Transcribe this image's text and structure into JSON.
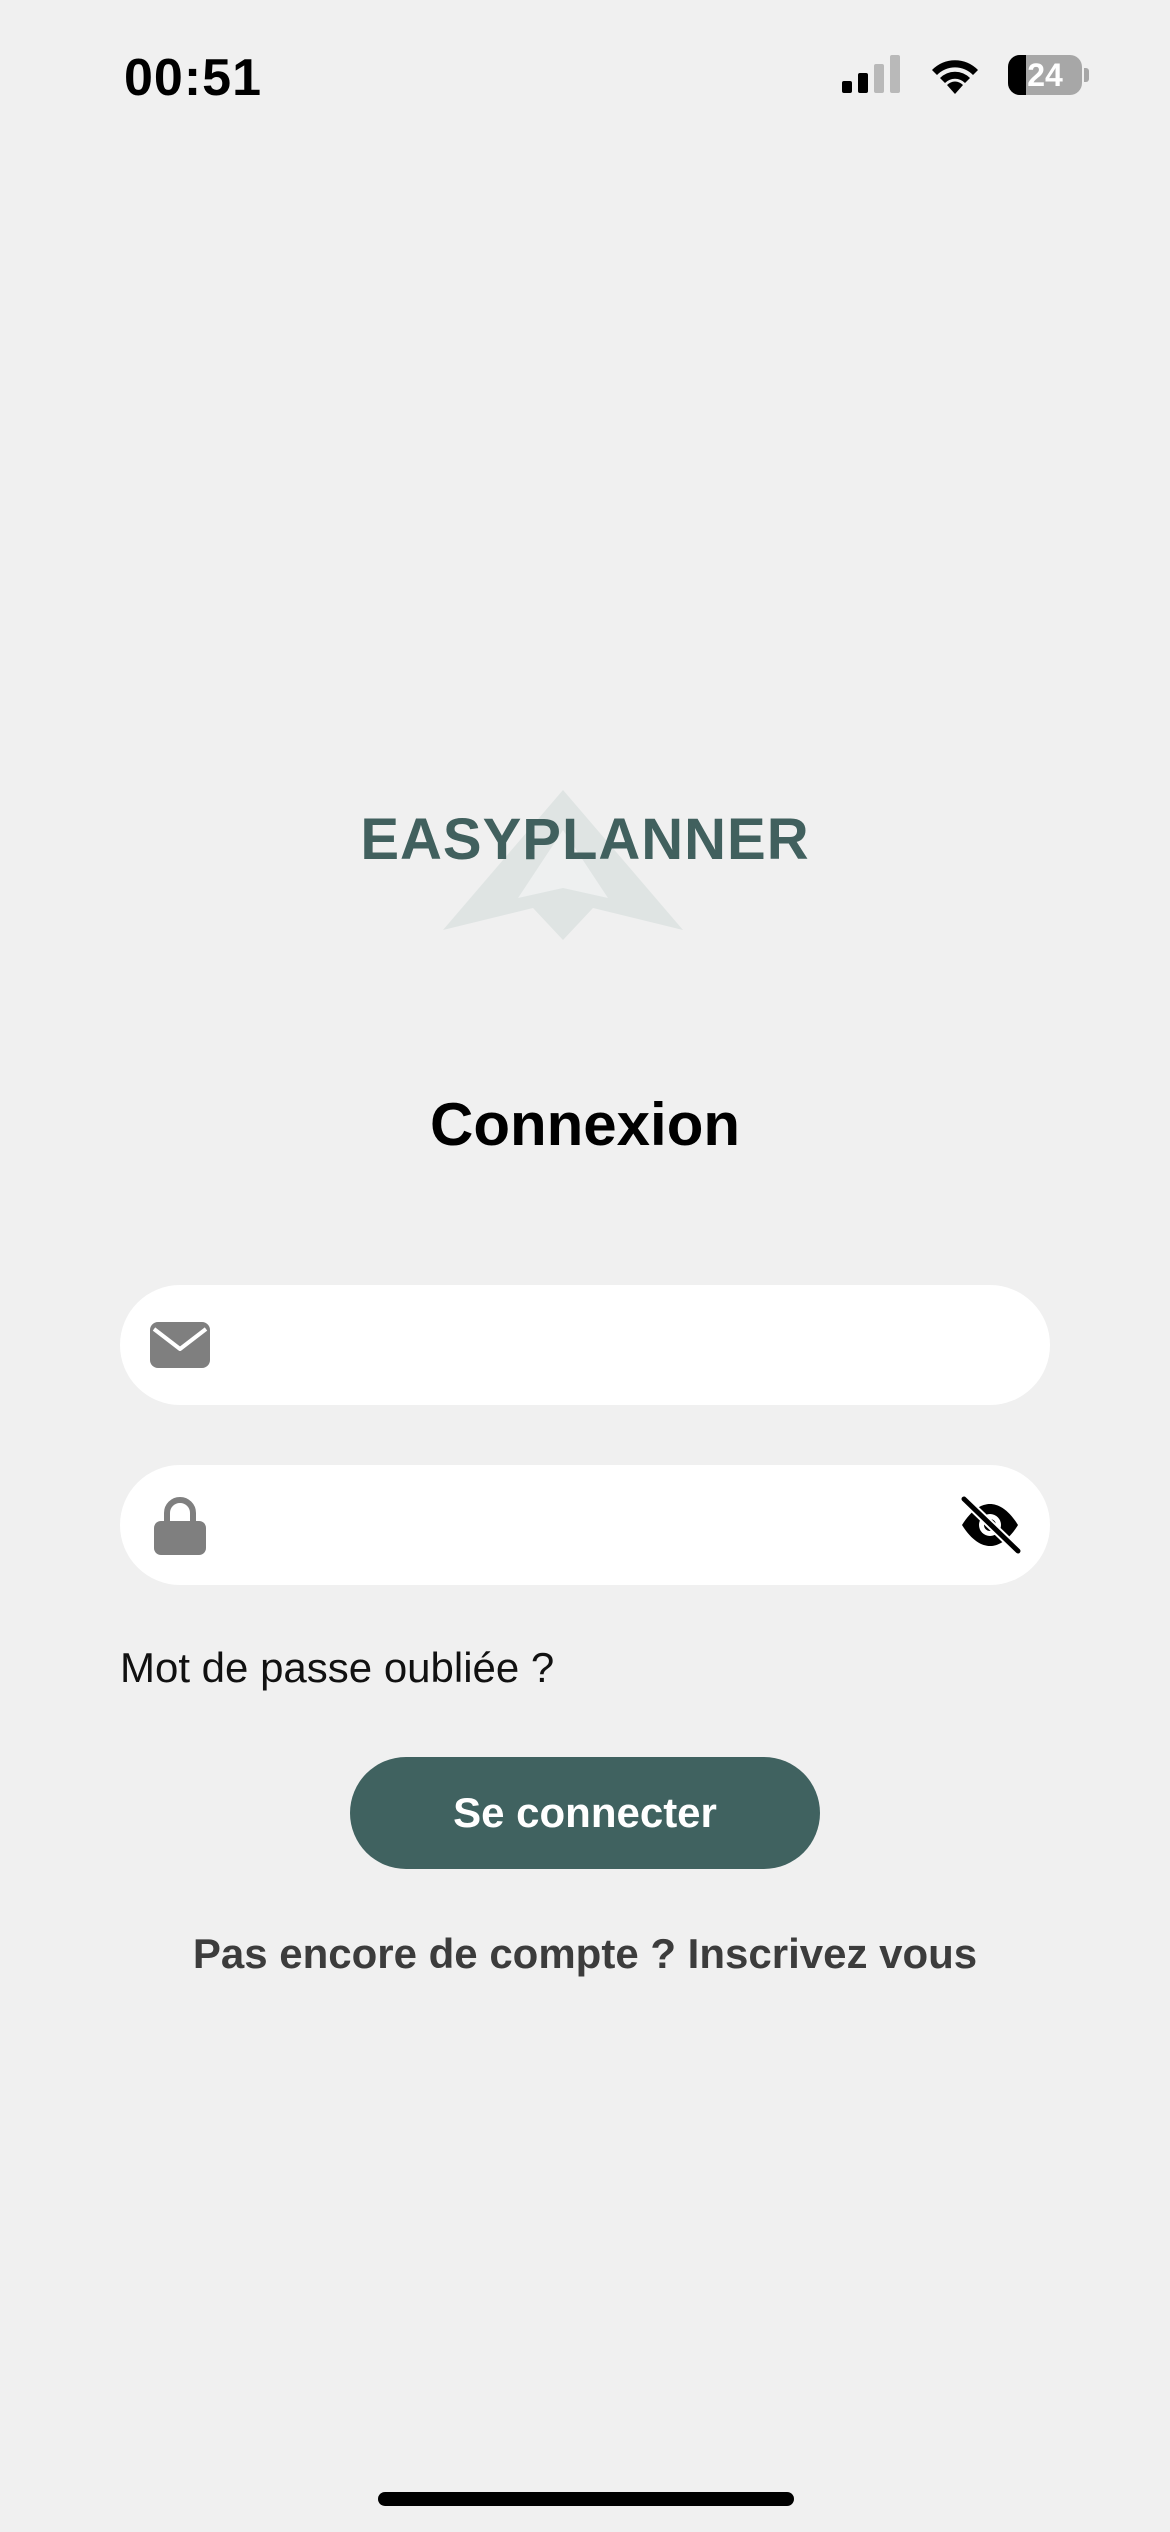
{
  "status_bar": {
    "time": "00:51",
    "battery_level": "24",
    "battery_fraction": 0.24,
    "signal_bars_active": 2,
    "signal_bars_total": 4
  },
  "brand": {
    "name": "EASYPLANNER",
    "primary_color": "#406260"
  },
  "page": {
    "title": "Connexion"
  },
  "form": {
    "email": {
      "icon": "envelope-icon",
      "value": ""
    },
    "password": {
      "icon": "lock-icon",
      "toggle_icon": "eye-slash-icon",
      "value": ""
    },
    "forgot_password_label": "Mot de passe oubliée ?",
    "submit_label": "Se connecter",
    "signup_label": "Pas encore de compte ? Inscrivez vous"
  }
}
